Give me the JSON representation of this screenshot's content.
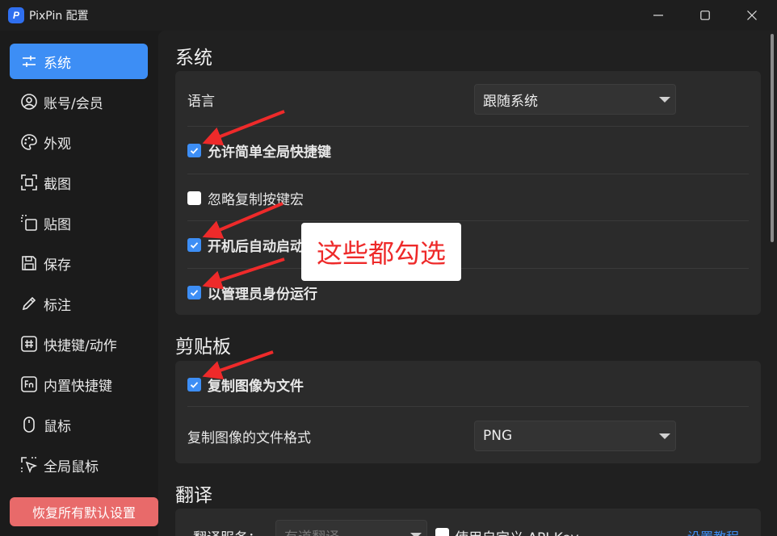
{
  "window": {
    "title": "PixPin 配置",
    "logo_letter": "P"
  },
  "sidebar": {
    "items": [
      {
        "label": "系统",
        "icon": "sliders-icon"
      },
      {
        "label": "账号/会员",
        "icon": "user-circle-icon"
      },
      {
        "label": "外观",
        "icon": "palette-icon"
      },
      {
        "label": "截图",
        "icon": "screenshot-icon"
      },
      {
        "label": "贴图",
        "icon": "pin-image-icon"
      },
      {
        "label": "保存",
        "icon": "save-icon"
      },
      {
        "label": "标注",
        "icon": "pencil-icon"
      },
      {
        "label": "快捷键/动作",
        "icon": "hash-icon"
      },
      {
        "label": "内置快捷键",
        "icon": "fn-key-icon"
      },
      {
        "label": "鼠标",
        "icon": "mouse-icon"
      },
      {
        "label": "全局鼠标",
        "icon": "cursor-select-icon"
      }
    ],
    "active_index": 0,
    "reset_label": "恢复所有默认设置"
  },
  "system": {
    "title": "系统",
    "language_label": "语言",
    "language_value": "跟随系统",
    "allow_hotkey_label": "允许简单全局快捷键",
    "allow_hotkey_checked": true,
    "ignore_macro_label": "忽略复制按键宏",
    "ignore_macro_checked": false,
    "autostart_label": "开机后自动启动",
    "autostart_checked": true,
    "admin_label": "以管理员身份运行",
    "admin_checked": true
  },
  "clipboard": {
    "title": "剪贴板",
    "copy_as_file_label": "复制图像为文件",
    "copy_as_file_checked": true,
    "format_label": "复制图像的文件格式",
    "format_value": "PNG"
  },
  "translate": {
    "title": "翻译",
    "service_label": "翻译服务：",
    "service_value": "有道翻译",
    "custom_key_label": "使用自定义 API Key",
    "custom_key_checked": false,
    "tutorial_link": "设置教程"
  },
  "annotation": {
    "callout_text": "这些都勾选",
    "color": "#ee2a2a"
  },
  "colors": {
    "accent": "#3d8ef5",
    "reset": "#e86a6a"
  }
}
